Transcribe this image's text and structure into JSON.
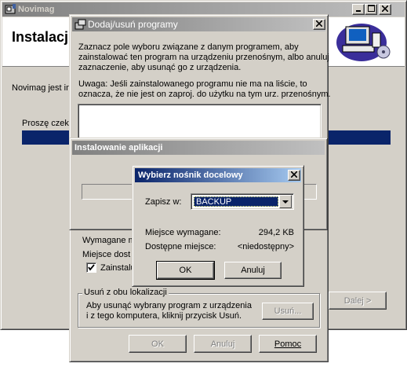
{
  "colors": {
    "title_active_start": "#0a246a",
    "title_active_end": "#a6caf0",
    "face": "#d4d0c8",
    "progress": "#0a246a"
  },
  "main_window": {
    "title": "Novimag",
    "header_title": "Instalacj",
    "body_text": "Novimag jest in",
    "wait_text": "Proszę czek",
    "next_button": "Dalej >",
    "icons": [
      "app-icon",
      "computer-pda-icon"
    ]
  },
  "add_remove": {
    "title": "Dodaj/usuń programy",
    "instructions": [
      "Zaznacz pole wyboru związane z danym programem, aby",
      "zainstalować ten program na urządzeniu przenośnym, albo anuluj",
      "zaznaczenie, aby usunąć go z urządzenia."
    ],
    "note": [
      "Uwaga: Jeśli zainstalowanego programu nie ma na liście, to",
      "oznacza, że nie jest on zaproj. do użytku na tym urz. przenośnym."
    ],
    "required_space_label": "Wymagane m",
    "available_space_label": "Miejsce dost",
    "checkbox_label": "Zainstalu",
    "remove_group": {
      "title": "Usuń z obu lokalizacji",
      "text": [
        "Aby usunąć wybrany program z urządzenia",
        "i z tego komputera, kliknij przycisk Usuń."
      ],
      "remove_button": "Usuń..."
    },
    "ok_button": "OK",
    "cancel_button": "Anuluj",
    "help_button": "Pomoc"
  },
  "installing": {
    "title": "Instalowanie aplikacji"
  },
  "media": {
    "title": "Wybierz nośnik docelowy",
    "save_in_label": "Zapisz w:",
    "selected_option": "BACKUP",
    "required_label": "Miejsce wymagane:",
    "required_value": "294,2 KB",
    "available_label": "Dostępne miejsce:",
    "available_value": "<niedostępny>",
    "ok_button": "OK",
    "cancel_button": "Anuluj"
  }
}
